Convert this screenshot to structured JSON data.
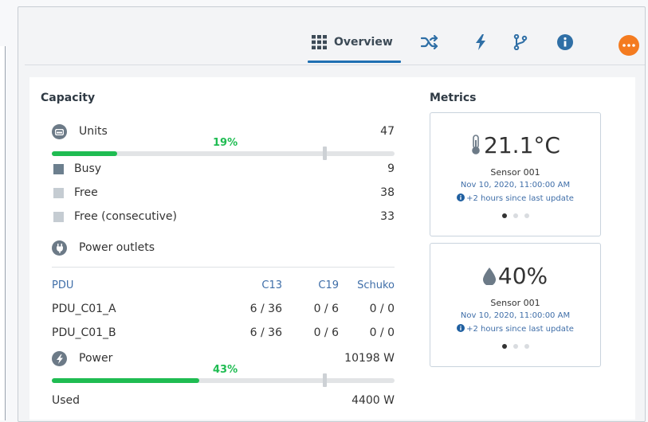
{
  "tabs": {
    "overview_label": "Overview",
    "icons": [
      "grid-icon",
      "shuffle-icon",
      "bolt-icon",
      "branch-icon",
      "info-icon",
      "more-icon"
    ]
  },
  "capacity": {
    "title": "Capacity",
    "units": {
      "label": "Units",
      "percent_text": "19%",
      "percent": 19,
      "total": "47"
    },
    "busy": {
      "label": "Busy",
      "value": "9",
      "color": "#6c7f8e"
    },
    "free": {
      "label": "Free",
      "value": "38",
      "color": "#c5ccd2"
    },
    "free_consecutive": {
      "label": "Free (consecutive)",
      "value": "33",
      "color": "#c5ccd2"
    },
    "power_outlets": {
      "label": "Power outlets"
    },
    "pdu_table": {
      "headers": [
        "PDU",
        "C13",
        "C19",
        "Schuko"
      ],
      "rows": [
        [
          "PDU_C01_A",
          "6 / 36",
          "0 / 6",
          "0 / 0"
        ],
        [
          "PDU_C01_B",
          "6 / 36",
          "0 / 6",
          "0 / 0"
        ]
      ]
    },
    "power": {
      "label": "Power",
      "percent_text": "43%",
      "percent": 43,
      "total": "10198 W"
    },
    "used": {
      "label": "Used",
      "value": "4400 W"
    }
  },
  "metrics": {
    "title": "Metrics",
    "cards": [
      {
        "value": "21.1°C",
        "sensor": "Sensor 001",
        "date": "Nov 10, 2020, 11:00:00 AM",
        "since": "+2 hours since last update",
        "icon": "thermometer-icon"
      },
      {
        "value": "40%",
        "sensor": "Sensor 001",
        "date": "Nov 10, 2020, 11:00:00 AM",
        "since": "+2 hours since last update",
        "icon": "water-drop-icon"
      }
    ]
  },
  "colors": {
    "accent": "#1f6fb2",
    "green": "#1fbc52",
    "orange": "#f47b20"
  }
}
